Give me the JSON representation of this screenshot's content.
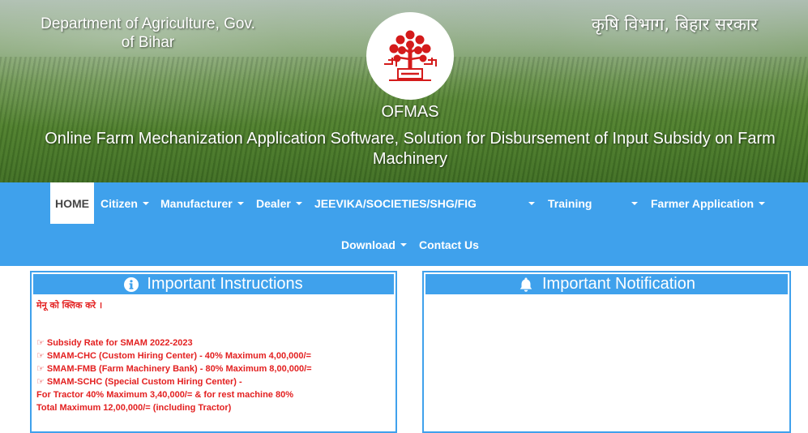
{
  "header": {
    "dept_en": "Department of Agriculture, Gov. of Bihar",
    "dept_hi": "कृषि विभाग, बिहार सरकार",
    "app_name": "OFMAS",
    "app_desc": "Online Farm Mechanization Application Software, Solution for Disbursement of Input Subsidy on Farm Machinery",
    "logo_icon": "bihar-bodhi-tree-seal-icon"
  },
  "nav": {
    "items": [
      {
        "label": "HOME",
        "active": true
      },
      {
        "label": "Citizen",
        "dropdown": true
      },
      {
        "label": "Manufacturer",
        "dropdown": true
      },
      {
        "label": "Dealer",
        "dropdown": true
      },
      {
        "label": "JEEVIKA/SOCIETIES/SHG/FIG",
        "dropdown": true
      },
      {
        "label": "Training",
        "dropdown": true
      },
      {
        "label": "Farmer Application",
        "dropdown": true
      },
      {
        "label": "Download",
        "dropdown": true
      },
      {
        "label": "Contact Us"
      }
    ]
  },
  "instructions": {
    "title": "Important Instructions",
    "icon": "info-circle-icon",
    "lines": [
      "मेनू को क्लिक करे ।",
      "Subsidy Rate for SMAM 2022-2023",
      "SMAM-CHC (Custom Hiring Center) - 40% Maximum 4,00,000/=",
      "SMAM-FMB (Farm Machinery Bank) - 80% Maximum 8,00,000/=",
      "SMAM-SCHC (Special Custom Hiring Center) -",
      "For Tractor 40% Maximum 3,40,000/= & for rest machine 80%",
      "Total Maximum 12,00,000/= (including Tractor)"
    ]
  },
  "notification": {
    "title": "Important Notification",
    "icon": "bell-icon"
  },
  "colors": {
    "nav_bg": "#3fa1ec",
    "instruction_text": "#e32020"
  }
}
